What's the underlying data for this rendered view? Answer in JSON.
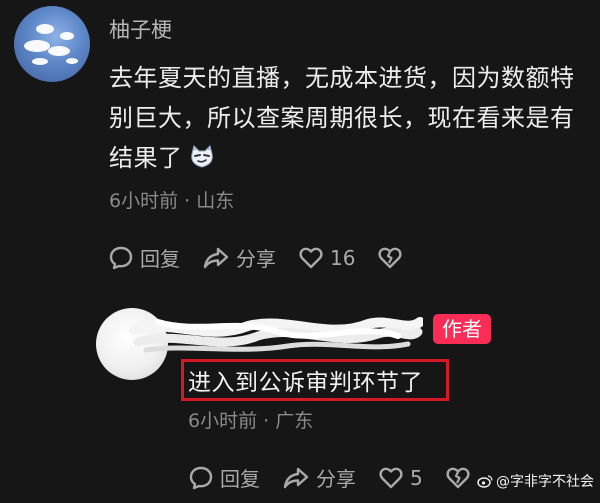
{
  "comment": {
    "username": "柚子梗",
    "text": "去年夏天的直播，无成本进货，因为数额特别巨大，所以查案周期很长，现在看来是有结果了",
    "emoji_icon": "smirk-cat-emoji",
    "time": "6小时前",
    "location": "山东",
    "reply_label": "回复",
    "share_label": "分享",
    "like_count": "16"
  },
  "reply": {
    "author_badge": "作者",
    "text": "进入到公诉审判环节了",
    "time": "6小时前",
    "location": "广东",
    "reply_label": "回复",
    "share_label": "分享",
    "like_count": "5"
  },
  "watermark": {
    "text": "@字非字不社会"
  },
  "colors": {
    "background": "#161616",
    "badge": "#fb2c55",
    "highlight": "#d51a25"
  }
}
